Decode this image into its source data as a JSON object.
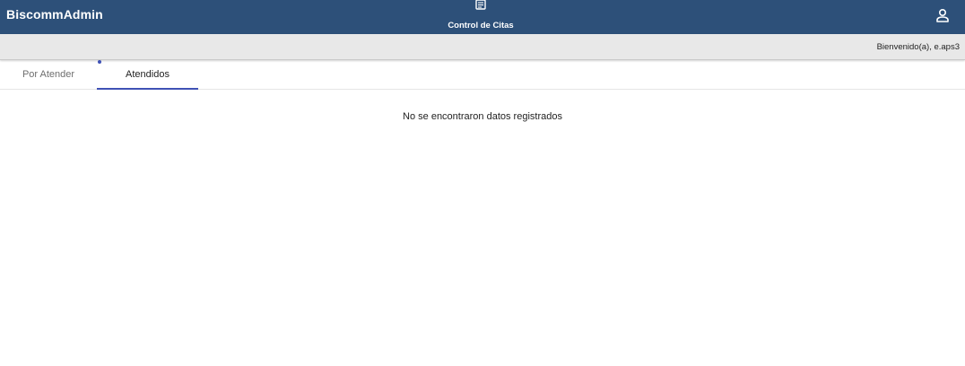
{
  "header": {
    "brand": "BiscommAdmin",
    "nav_item": {
      "label": "Control de Citas",
      "icon": "document-list-icon"
    },
    "user_icon": "user-icon",
    "background_color": "#2d5079"
  },
  "subheader": {
    "welcome": "Bienvenido(a), e.aps3"
  },
  "tabs": [
    {
      "label": "Por Atender",
      "active": false
    },
    {
      "label": "Atendidos",
      "active": true
    }
  ],
  "accent_color": "#3f51b5",
  "main": {
    "empty_message": "No se encontraron datos registrados"
  }
}
